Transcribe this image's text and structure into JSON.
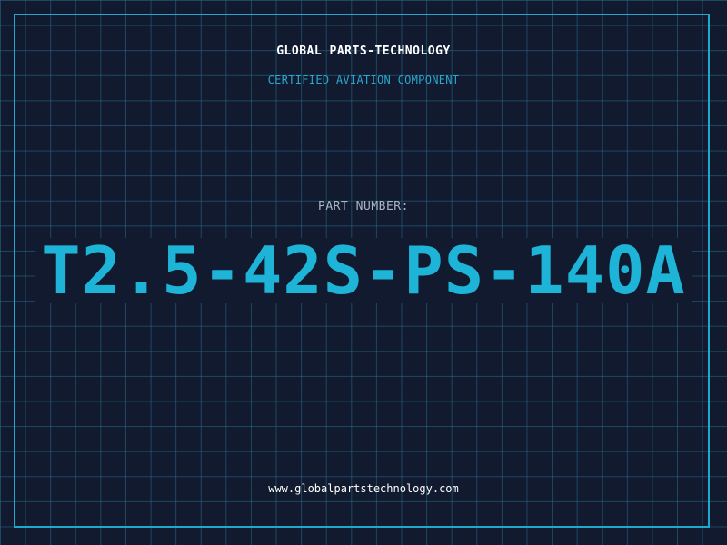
{
  "header": {
    "company_name": "GLOBAL PARTS-TECHNOLOGY",
    "certification": "CERTIFIED AVIATION COMPONENT"
  },
  "part": {
    "label": "PART NUMBER:",
    "number": "T2.5-42S-PS-140A"
  },
  "footer": {
    "website": "www.globalpartstechnology.com"
  },
  "colors": {
    "background": "#111a2e",
    "grid": "#286e8c",
    "frame": "#1fa9c9",
    "accent": "#1eb4d8",
    "label": "#aab4c4",
    "text": "#ffffff"
  }
}
